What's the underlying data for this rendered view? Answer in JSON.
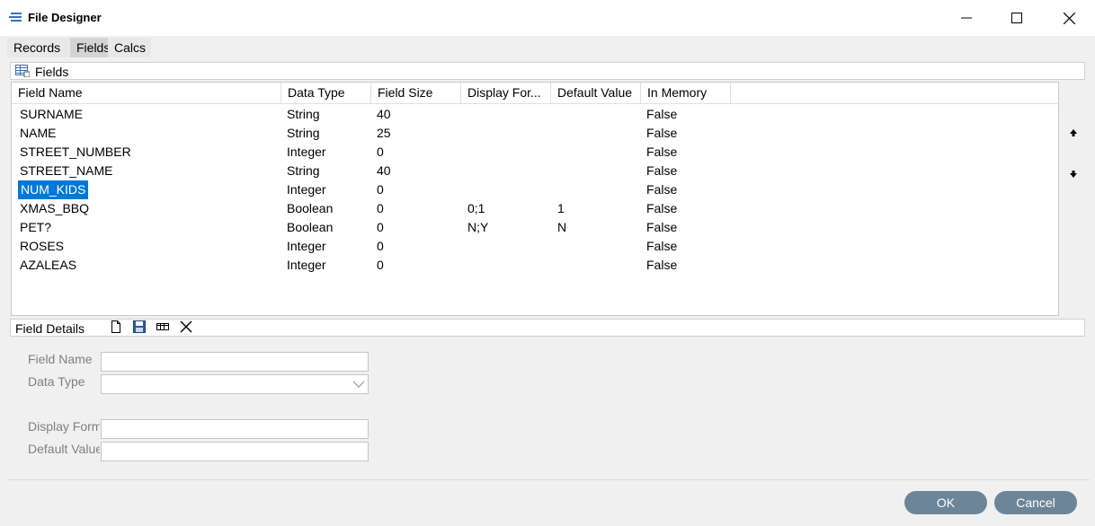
{
  "window": {
    "title": "File Designer"
  },
  "tabs": [
    {
      "label": "Records"
    },
    {
      "label": "Fields"
    },
    {
      "label": "Calcs"
    }
  ],
  "fields_section": {
    "label": "Fields"
  },
  "grid": {
    "columns": [
      "Field Name",
      "Data Type",
      "Field Size",
      "Display For...",
      "Default Value",
      "In Memory"
    ],
    "rows": [
      [
        "SURNAME",
        "String",
        "40",
        "",
        "",
        "False"
      ],
      [
        "NAME",
        "String",
        "25",
        "",
        "",
        "False"
      ],
      [
        "STREET_NUMBER",
        "Integer",
        "0",
        "",
        "",
        "False"
      ],
      [
        "STREET_NAME",
        "String",
        "40",
        "",
        "",
        "False"
      ],
      [
        "NUM_KIDS",
        "Integer",
        "0",
        "",
        "",
        "False"
      ],
      [
        "XMAS_BBQ",
        "Boolean",
        "0",
        "0;1",
        "1",
        "False"
      ],
      [
        "PET?",
        "Boolean",
        "0",
        "N;Y",
        "N",
        "False"
      ],
      [
        "ROSES",
        "Integer",
        "0",
        "",
        "",
        "False"
      ],
      [
        "AZALEAS",
        "Integer",
        "0",
        "",
        "",
        "False"
      ]
    ],
    "selected_row": 4
  },
  "details_section": {
    "label": "Field Details"
  },
  "form": {
    "field_name_label": "Field Name",
    "data_type_label": "Data Type",
    "display_format_label": "Display Form",
    "default_value_label": "Default Value",
    "field_name_value": "",
    "data_type_value": "",
    "display_format_value": "",
    "default_value_value": ""
  },
  "buttons": {
    "ok": "OK",
    "cancel": "Cancel"
  },
  "colors": {
    "selection": "#0078d7",
    "button": "#6d8599"
  }
}
